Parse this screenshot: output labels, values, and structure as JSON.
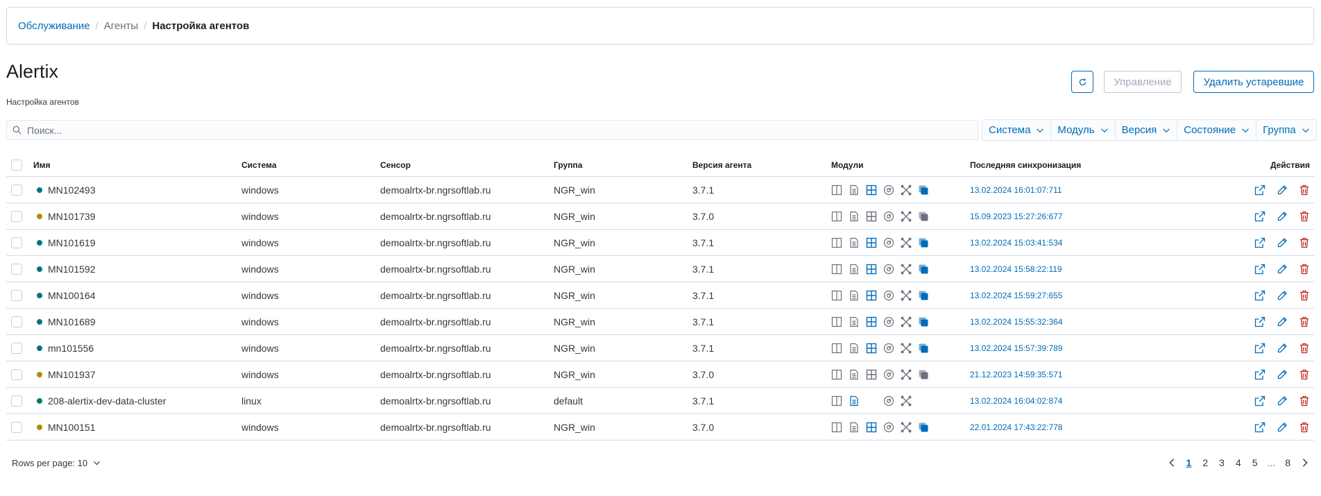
{
  "breadcrumb": {
    "items": [
      "Обслуживание",
      "Агенты",
      "Настройка агентов"
    ]
  },
  "page": {
    "title": "Alertix",
    "subtitle": "Настройка агентов"
  },
  "toolbar": {
    "manage_label": "Управление",
    "delete_stale_label": "Удалить устаревшие"
  },
  "search": {
    "placeholder": "Поиск..."
  },
  "filters": [
    "Система",
    "Модуль",
    "Версия",
    "Состояние",
    "Группа"
  ],
  "table": {
    "headers": {
      "name": "Имя",
      "system": "Система",
      "sensor": "Сенсор",
      "group": "Группа",
      "version": "Версия агента",
      "modules": "Модули",
      "last_sync": "Последняя синхронизация",
      "actions": "Действия"
    },
    "rows": [
      {
        "name": "MN102493",
        "status": "active",
        "system": "windows",
        "sensor": "demoalrtx-br.ngrsoftlab.ru",
        "group": "NGR_win",
        "version": "3.7.1",
        "last_sync": "13.02.2024 16:01:07:711",
        "modules": "full-active"
      },
      {
        "name": "MN101739",
        "status": "stale",
        "system": "windows",
        "sensor": "demoalrtx-br.ngrsoftlab.ru",
        "group": "NGR_win",
        "version": "3.7.0",
        "last_sync": "15.09.2023 15:27:26:677",
        "modules": "full-inactive"
      },
      {
        "name": "MN101619",
        "status": "active",
        "system": "windows",
        "sensor": "demoalrtx-br.ngrsoftlab.ru",
        "group": "NGR_win",
        "version": "3.7.1",
        "last_sync": "13.02.2024 15:03:41:534",
        "modules": "full-active"
      },
      {
        "name": "MN101592",
        "status": "active",
        "system": "windows",
        "sensor": "demoalrtx-br.ngrsoftlab.ru",
        "group": "NGR_win",
        "version": "3.7.1",
        "last_sync": "13.02.2024 15:58:22:119",
        "modules": "full-active"
      },
      {
        "name": "MN100164",
        "status": "active",
        "system": "windows",
        "sensor": "demoalrtx-br.ngrsoftlab.ru",
        "group": "NGR_win",
        "version": "3.7.1",
        "last_sync": "13.02.2024 15:59:27:655",
        "modules": "full-active"
      },
      {
        "name": "MN101689",
        "status": "active",
        "system": "windows",
        "sensor": "demoalrtx-br.ngrsoftlab.ru",
        "group": "NGR_win",
        "version": "3.7.1",
        "last_sync": "13.02.2024 15:55:32:364",
        "modules": "full-active"
      },
      {
        "name": "mn101556",
        "status": "active",
        "system": "windows",
        "sensor": "demoalrtx-br.ngrsoftlab.ru",
        "group": "NGR_win",
        "version": "3.7.1",
        "last_sync": "13.02.2024 15:57:39:789",
        "modules": "full-active"
      },
      {
        "name": "MN101937",
        "status": "stale",
        "system": "windows",
        "sensor": "demoalrtx-br.ngrsoftlab.ru",
        "group": "NGR_win",
        "version": "3.7.0",
        "last_sync": "21.12.2023 14:59:35:571",
        "modules": "full-inactive"
      },
      {
        "name": "208-alertix-dev-data-cluster",
        "status": "active",
        "system": "linux",
        "sensor": "demoalrtx-br.ngrsoftlab.ru",
        "group": "default",
        "version": "3.7.1",
        "last_sync": "13.02.2024 16:04:02:874",
        "modules": "linux"
      },
      {
        "name": "MN100151",
        "status": "stale",
        "system": "windows",
        "sensor": "demoalrtx-br.ngrsoftlab.ru",
        "group": "NGR_win",
        "version": "3.7.0",
        "last_sync": "22.01.2024 17:43:22:778",
        "modules": "full-active"
      }
    ]
  },
  "pagination": {
    "rows_per_page_label": "Rows per page: 10",
    "pages": [
      "1",
      "2",
      "3",
      "4",
      "5"
    ],
    "ellipsis": "...",
    "last_page": "8",
    "current": "1"
  },
  "colors": {
    "accent": "#006bb8",
    "status_active": "#007871",
    "status_stale": "#b88a00",
    "danger": "#bd271e",
    "module_inactive": "#69707d"
  },
  "icons": {
    "modules": [
      "columns-icon",
      "document-icon",
      "grid-icon",
      "gauge-icon",
      "network-icon",
      "stack-icon"
    ],
    "actions": [
      "open-external-icon",
      "edit-icon",
      "delete-icon"
    ]
  }
}
